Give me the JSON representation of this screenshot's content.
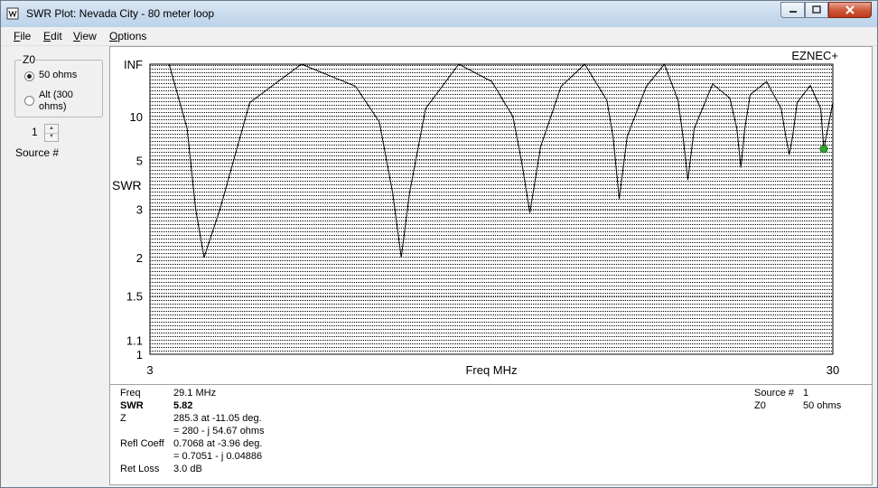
{
  "window": {
    "title": "SWR Plot: Nevada City - 80 meter loop"
  },
  "menu": [
    "File",
    "Edit",
    "View",
    "Options"
  ],
  "z0_group": {
    "title": "Z0",
    "options": [
      {
        "label": "50 ohms",
        "checked": true
      },
      {
        "label_line1": "Alt (300",
        "label_line2": "ohms)",
        "checked": false
      }
    ]
  },
  "source_spinner": {
    "value": "1",
    "label": "Source #"
  },
  "plot": {
    "watermark": "EZNEC+",
    "ylabel": "SWR",
    "xlabel": "Freq MHz",
    "yticks": [
      {
        "label": "INF",
        "swr": "inf"
      },
      {
        "label": "10",
        "swr": 10
      },
      {
        "label": "5",
        "swr": 5
      },
      {
        "label": "3",
        "swr": 3
      },
      {
        "label": "2",
        "swr": 2
      },
      {
        "label": "1.5",
        "swr": 1.5
      },
      {
        "label": "1.1",
        "swr": 1.1
      },
      {
        "label": "1",
        "swr": 1
      }
    ],
    "xticks": [
      "3",
      "30"
    ]
  },
  "chart_data": {
    "type": "line",
    "xlabel": "Freq MHz",
    "ylabel": "SWR",
    "xlim": [
      3,
      30
    ],
    "ylim": [
      1,
      "INF"
    ],
    "grid": true,
    "series": [
      {
        "x": [
          3.0,
          3.2,
          3.4,
          3.5,
          3.6,
          3.8,
          4.2,
          5.0,
          6.0,
          6.5,
          6.8,
          7.0,
          7.2,
          7.6,
          8.5,
          9.5,
          10.2,
          10.5,
          10.8,
          11.2,
          12.0,
          13.0,
          14.0,
          14.3,
          14.6,
          15.0,
          16.0,
          17.0,
          17.8,
          18.1,
          18.4,
          18.8,
          20.0,
          21.2,
          21.7,
          22.0,
          22.3,
          22.7,
          24.0,
          25.2,
          25.6,
          25.9,
          26.2,
          26.6,
          27.8,
          28.8,
          29.1,
          29.5,
          30.0
        ],
        "y": [
          "INF",
          "INF",
          8,
          3,
          2.0,
          3,
          14,
          "INF",
          25,
          9,
          3.5,
          2.0,
          3.5,
          12,
          "INF",
          32,
          10,
          5,
          2.9,
          6,
          25,
          "INF",
          15,
          7,
          3.3,
          7,
          25,
          "INF",
          15,
          7,
          4.0,
          8,
          28,
          16,
          8,
          4.6,
          8,
          18,
          32,
          12,
          7,
          5.4,
          7,
          14,
          26,
          12,
          5.82,
          8,
          14
        ]
      }
    ],
    "marker": {
      "x": 29.1,
      "y": 5.82,
      "color": "#2fa82f"
    }
  },
  "readout_left": [
    {
      "label": "Freq",
      "value": "29.1 MHz",
      "bold": false
    },
    {
      "label": "SWR",
      "value": "5.82",
      "bold": true
    },
    {
      "label": "Z",
      "value": "285.3 at -11.05 deg.",
      "bold": false
    },
    {
      "label": "",
      "value": "= 280 - j 54.67 ohms",
      "bold": false
    },
    {
      "label": "Refl Coeff",
      "value": "0.7068 at -3.96 deg.",
      "bold": false
    },
    {
      "label": "",
      "value": "= 0.7051 - j 0.04886",
      "bold": false
    },
    {
      "label": "Ret Loss",
      "value": "3.0 dB",
      "bold": false
    }
  ],
  "readout_right": [
    {
      "label": "Source #",
      "value": "1"
    },
    {
      "label": "Z0",
      "value": "50 ohms"
    }
  ],
  "colors": {
    "curve": "#000000",
    "grid": "#000000",
    "marker": "#2fa82f",
    "title_bar": "#c9dbee",
    "close_button": "#c94a2c"
  }
}
